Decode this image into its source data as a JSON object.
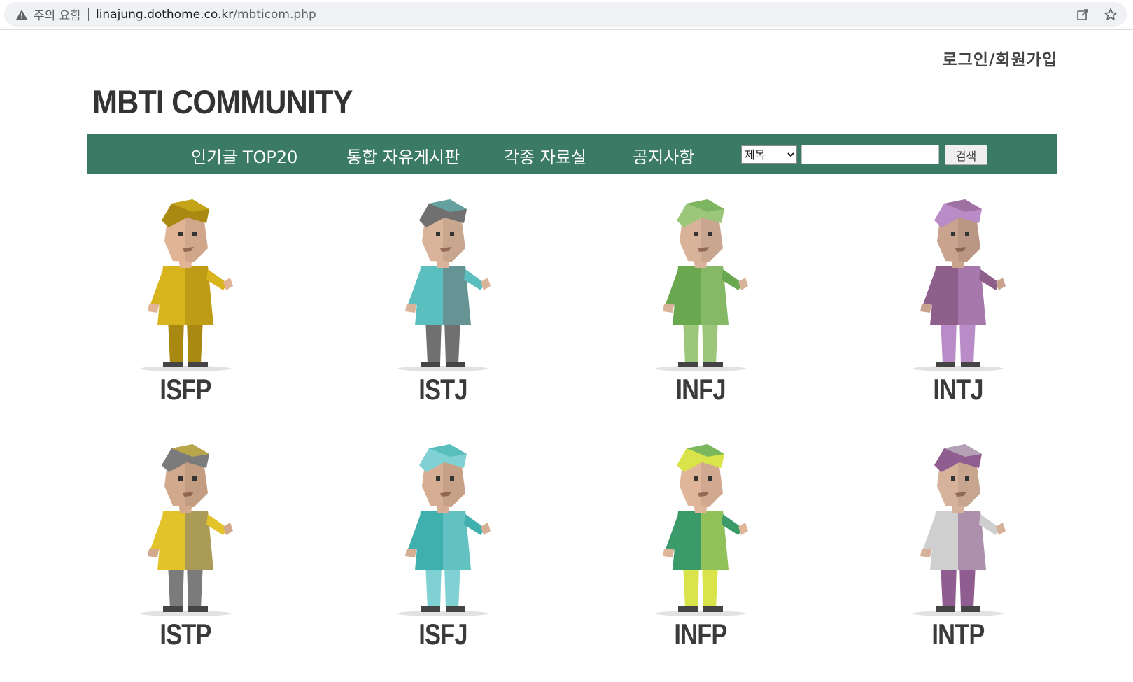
{
  "browser": {
    "warning_text": "주의 요함",
    "url_host": "linajung.dothome.co.kr",
    "url_path": "/mbticom.php",
    "icons": [
      "warning-icon",
      "share-icon",
      "star-icon"
    ]
  },
  "header": {
    "login_label": "로그인/회원가입",
    "site_title": "MBTI COMMUNITY"
  },
  "nav": {
    "items": [
      "인기글 TOP20",
      "통합 자유게시판",
      "각종 자료실",
      "공지사항"
    ],
    "search_select_value": "제목",
    "search_input_value": "",
    "search_button_label": "검색"
  },
  "types": [
    {
      "label": "ISFP",
      "primary": "#d8b41c",
      "secondary": "#a98912",
      "skin": "#e0b495"
    },
    {
      "label": "ISTJ",
      "primary": "#5bbfc0",
      "secondary": "#707070",
      "skin": "#d9b49a"
    },
    {
      "label": "INFJ",
      "primary": "#6aa84f",
      "secondary": "#9cc77a",
      "skin": "#d8b39a"
    },
    {
      "label": "INTJ",
      "primary": "#8e5f8a",
      "secondary": "#b98cc8",
      "skin": "#c9a38e"
    },
    {
      "label": "ISTP",
      "primary": "#e3c32a",
      "secondary": "#7b7b7b",
      "skin": "#d2a98c"
    },
    {
      "label": "ISFJ",
      "primary": "#3fb0ad",
      "secondary": "#7fd1d3",
      "skin": "#d6ae93"
    },
    {
      "label": "INFP",
      "primary": "#3a9a6a",
      "secondary": "#d9e34a",
      "skin": "#e0b69b"
    },
    {
      "label": "INTP",
      "primary": "#cfcfcf",
      "secondary": "#8f5d90",
      "skin": "#d7b29a"
    }
  ]
}
